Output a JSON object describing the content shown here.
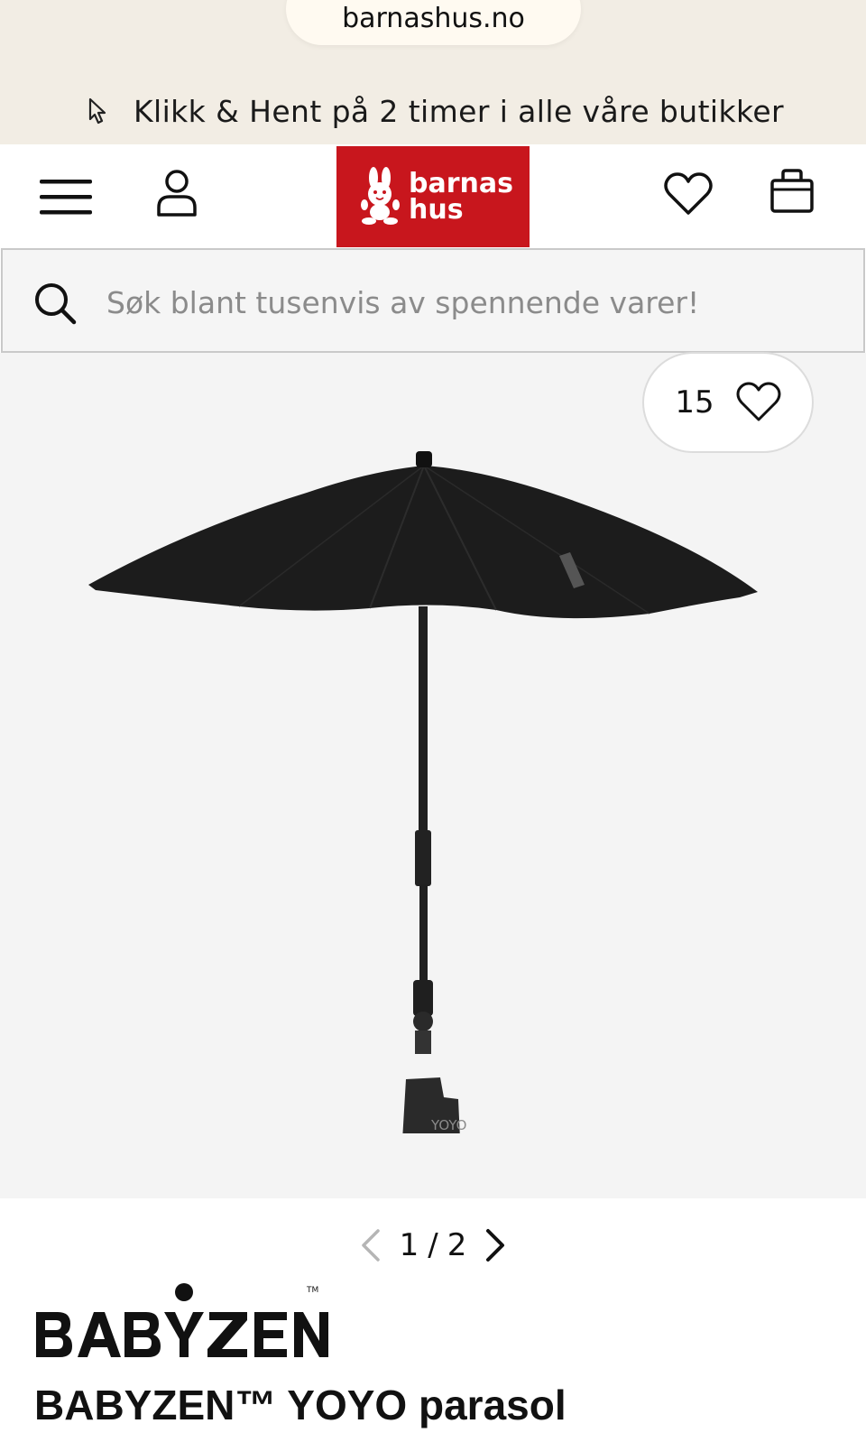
{
  "browser": {
    "url": "barnashus.no"
  },
  "promo": {
    "text": "Klikk & Hent på 2 timer i alle våre butikker",
    "icon": "cursor-pointer-icon"
  },
  "header": {
    "logo_line1": "barnas",
    "logo_line2": "hus",
    "logo_color": "#c8161d",
    "icons": [
      "menu-icon",
      "user-icon",
      "heart-icon",
      "shopping-bag-icon"
    ]
  },
  "search": {
    "placeholder": "Søk blant tusenvis av spennende varer!",
    "value": ""
  },
  "product": {
    "favorites_count": "15",
    "brand": "BABYZEN",
    "title": "BABYZEN™ YOYO parasol",
    "image_pager": {
      "current": "1",
      "separator": "/",
      "total": "2"
    }
  }
}
